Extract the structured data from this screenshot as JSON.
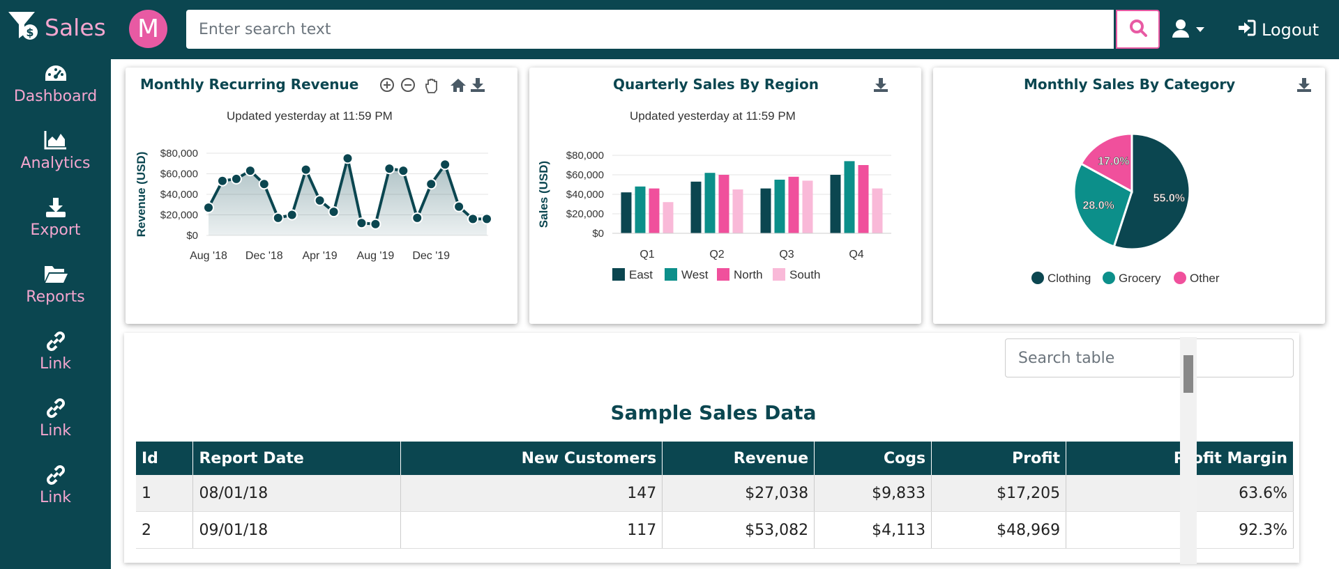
{
  "brand": {
    "name": "Sales"
  },
  "sidebar": {
    "items": [
      {
        "label": "Dashboard",
        "icon": "gauge-icon"
      },
      {
        "label": "Analytics",
        "icon": "area-chart-icon"
      },
      {
        "label": "Export",
        "icon": "download-icon"
      },
      {
        "label": "Reports",
        "icon": "folder-open-icon"
      },
      {
        "label": "Link",
        "icon": "link-icon"
      },
      {
        "label": "Link",
        "icon": "link-icon"
      },
      {
        "label": "Link",
        "icon": "link-icon"
      }
    ]
  },
  "header": {
    "avatar_letter": "M",
    "search_placeholder": "Enter search text",
    "logout_label": "Logout"
  },
  "colors": {
    "primary": "#0b4650",
    "teal": "#0c8f8a",
    "pink": "#f0509c",
    "light_pink": "#f9b9d8",
    "sidebar_text": "#f4a6cf"
  },
  "cards": {
    "mrr": {
      "title": "Monthly Recurring Revenue",
      "subtitle": "Updated yesterday at 11:59 PM"
    },
    "quarterly": {
      "title": "Quarterly Sales By Region",
      "subtitle": "Updated yesterday at 11:59 PM"
    },
    "category": {
      "title": "Monthly Sales By Category"
    }
  },
  "chart_data": [
    {
      "type": "area",
      "title": "Monthly Recurring Revenue",
      "ylabel": "Revenue (USD)",
      "x_ticks": [
        "Aug '18",
        "Dec '18",
        "Apr '19",
        "Aug '19",
        "Dec '19"
      ],
      "y_ticks": [
        "$0",
        "$20,000",
        "$40,000",
        "$60,000",
        "$80,000"
      ],
      "ylim": [
        0,
        80000
      ],
      "x": [
        "Aug '18",
        "Sep '18",
        "Oct '18",
        "Nov '18",
        "Dec '18",
        "Jan '19",
        "Feb '19",
        "Mar '19",
        "Apr '19",
        "May '19",
        "Jun '19",
        "Jul '19",
        "Aug '19",
        "Sep '19",
        "Oct '19",
        "Nov '19",
        "Dec '19",
        "Jan '20",
        "Feb '20",
        "Mar '20",
        "Apr '20"
      ],
      "values": [
        27038,
        53082,
        55000,
        63000,
        50000,
        17000,
        20000,
        64000,
        34000,
        23000,
        75000,
        12000,
        11000,
        65000,
        63000,
        17000,
        50000,
        69000,
        28000,
        16000,
        16000
      ]
    },
    {
      "type": "bar",
      "title": "Quarterly Sales By Region",
      "ylabel": "Sales (USD)",
      "categories": [
        "Q1",
        "Q2",
        "Q3",
        "Q4"
      ],
      "y_ticks": [
        "$0",
        "$20,000",
        "$40,000",
        "$60,000",
        "$80,000"
      ],
      "ylim": [
        0,
        80000
      ],
      "series": [
        {
          "name": "East",
          "values": [
            42000,
            53000,
            46000,
            60000
          ]
        },
        {
          "name": "West",
          "values": [
            48000,
            62000,
            55000,
            74000
          ]
        },
        {
          "name": "North",
          "values": [
            46000,
            60000,
            58000,
            70000
          ]
        },
        {
          "name": "South",
          "values": [
            32000,
            45000,
            54000,
            46000
          ]
        }
      ]
    },
    {
      "type": "pie",
      "title": "Monthly Sales By Category",
      "categories": [
        "Clothing",
        "Grocery",
        "Other"
      ],
      "values": [
        55.0,
        28.0,
        17.0
      ],
      "labels": [
        "55.0%",
        "28.0%",
        "17.0%"
      ]
    }
  ],
  "table": {
    "search_placeholder": "Search table",
    "title": "Sample Sales Data",
    "columns": [
      "Id",
      "Report Date",
      "New Customers",
      "Revenue",
      "Cogs",
      "Profit",
      "Profit Margin"
    ],
    "rows": [
      [
        "1",
        "08/01/18",
        "147",
        "$27,038",
        "$9,833",
        "$17,205",
        "63.6%"
      ],
      [
        "2",
        "09/01/18",
        "117",
        "$53,082",
        "$4,113",
        "$48,969",
        "92.3%"
      ]
    ]
  }
}
